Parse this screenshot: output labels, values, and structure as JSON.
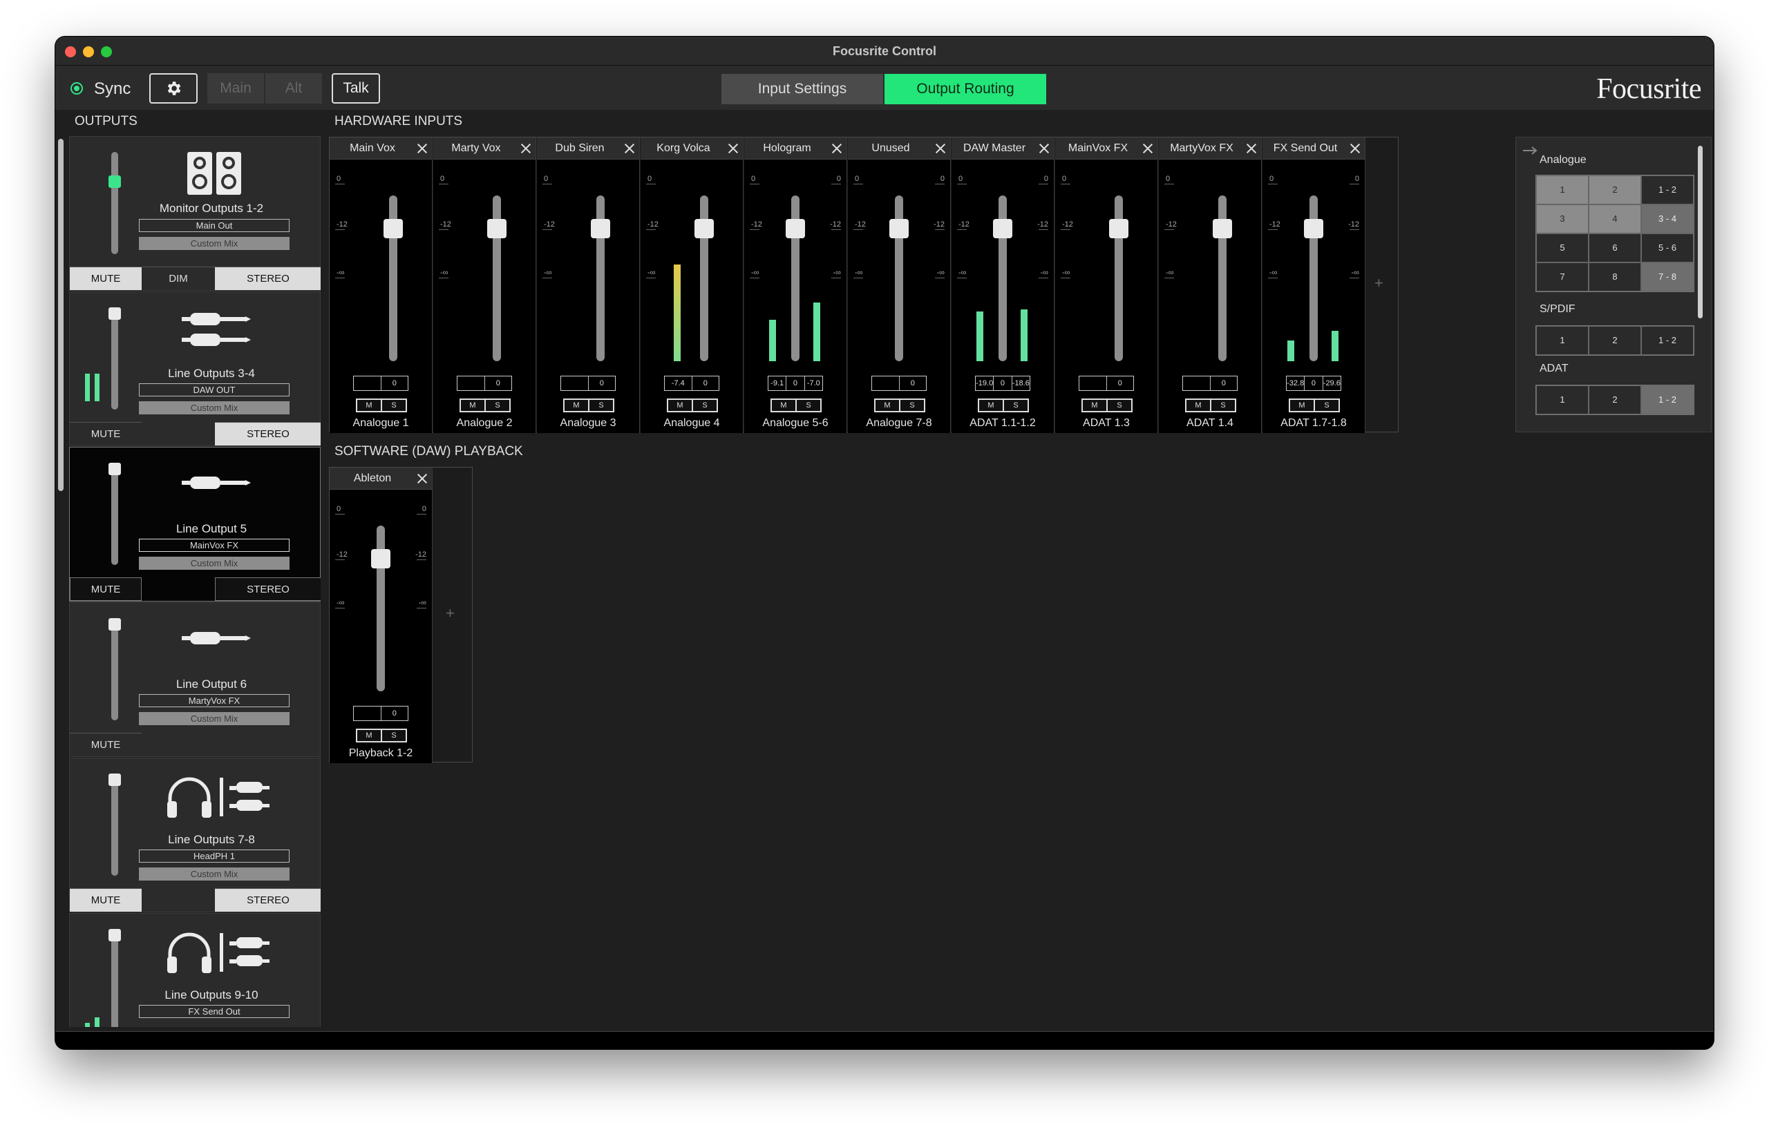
{
  "window": {
    "title": "Focusrite Control"
  },
  "toolbar": {
    "sync_label": "Sync",
    "main_label": "Main",
    "alt_label": "Alt",
    "talk_label": "Talk",
    "tabs": [
      {
        "label": "Input Settings",
        "active": false
      },
      {
        "label": "Output Routing",
        "active": true
      }
    ],
    "brand": "Focusrite",
    "accent": "#22e67a"
  },
  "outputs": {
    "heading": "OUTPUTS",
    "cards": [
      {
        "title": "Monitor Outputs 1-2",
        "route": "Main Out",
        "mix": "Custom Mix",
        "buttons": [
          "MUTE",
          "DIM",
          "STEREO"
        ],
        "icon": "speakers-icon"
      },
      {
        "title": "Line Outputs 3-4",
        "route": "DAW OUT",
        "mix": "Custom Mix",
        "buttons": [
          "MUTE",
          "STEREO"
        ],
        "icon": "jack-pair-icon"
      },
      {
        "title": "Line Output 5",
        "route": "MainVox FX",
        "mix": "Custom Mix",
        "buttons": [
          "MUTE",
          "STEREO"
        ],
        "icon": "jack-icon"
      },
      {
        "title": "Line Output 6",
        "route": "MartyVox FX",
        "mix": "Custom Mix",
        "buttons": [
          "MUTE"
        ],
        "icon": "jack-icon"
      },
      {
        "title": "Line Outputs 7-8",
        "route": "HeadPH 1",
        "mix": "Custom Mix",
        "buttons": [
          "MUTE",
          "STEREO"
        ],
        "icon": "headphones-icon"
      },
      {
        "title": "Line Outputs 9-10",
        "route": "FX Send Out",
        "mix": "",
        "buttons": [],
        "icon": "headphones-icon"
      }
    ]
  },
  "hardware_inputs": {
    "heading": "HARDWARE INPUTS",
    "scale": {
      "top": "0",
      "mid": "-12",
      "bottom": "-∞"
    },
    "strips": [
      {
        "name": "Main Vox",
        "source": "Analogue 1",
        "pan": [
          "0"
        ],
        "stereo": false
      },
      {
        "name": "Marty Vox",
        "source": "Analogue 2",
        "pan": [
          "0"
        ],
        "stereo": false
      },
      {
        "name": "Dub Siren",
        "source": "Analogue 3",
        "pan": [
          "0"
        ],
        "stereo": false
      },
      {
        "name": "Korg Volca",
        "source": "Analogue 4",
        "pan": [
          "-7.4",
          "0"
        ],
        "stereo": false
      },
      {
        "name": "Hologram",
        "source": "Analogue 5-6",
        "pan": [
          "-9.1",
          "0",
          "-7.0"
        ],
        "stereo": true
      },
      {
        "name": "Unused",
        "source": "Analogue 7-8",
        "pan": [
          "0"
        ],
        "stereo": true
      },
      {
        "name": "DAW Master",
        "source": "ADAT 1.1-1.2",
        "pan": [
          "-19.0",
          "0",
          "-18.6"
        ],
        "stereo": true
      },
      {
        "name": "MainVox FX",
        "source": "ADAT 1.3",
        "pan": [
          "0"
        ],
        "stereo": false
      },
      {
        "name": "MartyVox FX",
        "source": "ADAT 1.4",
        "pan": [
          "0"
        ],
        "stereo": false
      },
      {
        "name": "FX Send Out",
        "source": "ADAT 1.7-1.8",
        "pan": [
          "-32.8",
          "0",
          "-29.6"
        ],
        "stereo": true
      }
    ],
    "ms": {
      "mute": "M",
      "solo": "S"
    },
    "add": "+"
  },
  "software_playback": {
    "heading": "SOFTWARE (DAW) PLAYBACK",
    "strips": [
      {
        "name": "Ableton",
        "source": "Playback 1-2",
        "pan": [
          "0"
        ],
        "stereo": true
      }
    ],
    "add": "+"
  },
  "routing_panel": {
    "analogue_label": "Analogue",
    "analogue": [
      [
        "1",
        "2",
        "1 - 2"
      ],
      [
        "3",
        "4",
        "3 - 4"
      ],
      [
        "5",
        "6",
        "5 - 6"
      ],
      [
        "7",
        "8",
        "7 - 8"
      ]
    ],
    "spdif_label": "S/PDIF",
    "spdif": [
      "1",
      "2",
      "1 - 2"
    ],
    "adat_label": "ADAT",
    "adat": [
      "1",
      "2",
      "1 - 2"
    ]
  }
}
